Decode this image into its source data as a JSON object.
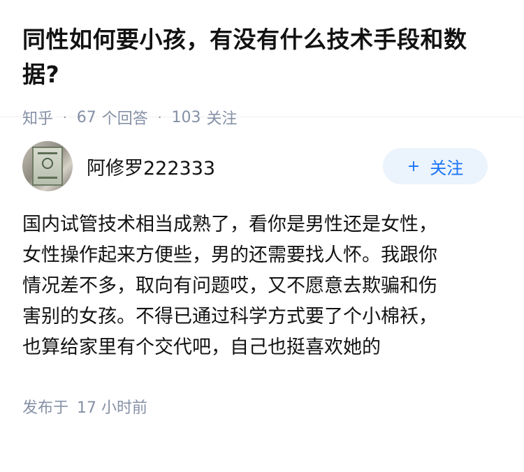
{
  "question": {
    "title": "同性如何要小孩，有没有什么技术手段和数据?",
    "source": "知乎",
    "answer_count": "67",
    "answer_label": "个回答",
    "follower_count": "103",
    "follower_label": "关注",
    "separator": "·"
  },
  "answer": {
    "author": "阿修罗222333",
    "follow_label": "关注",
    "follow_icon": "+",
    "lines": [
      "国内试管技术相当成熟了，看你是男性还是女性，",
      "女性操作起来方便些，男的还需要找人怀。我跟你",
      "情况差不多，取向有问题哎，又不愿意去欺骗和伤",
      "害别的女孩。不得已通过科学方式要了个小棉袄，",
      "也算给家里有个交代吧，自己也挺喜欢她的"
    ],
    "published_label": "发布于",
    "published_time": "17 小时前"
  },
  "colors": {
    "accent": "#1772f6",
    "follow_bg": "#ebf3fd",
    "meta_text": "#8590a6",
    "main_text": "#121212"
  }
}
